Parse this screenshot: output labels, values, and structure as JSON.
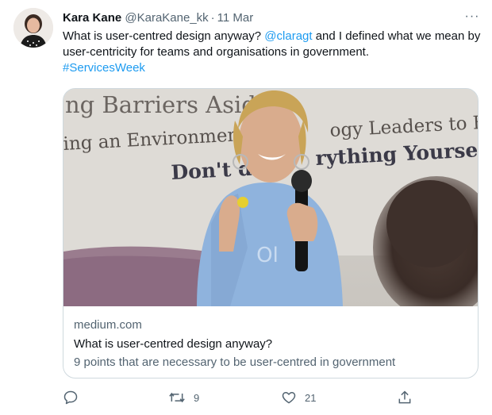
{
  "author": {
    "display_name": "Kara Kane",
    "handle": "@KaraKane_kk",
    "separator": "·",
    "time": "11 Mar"
  },
  "tweet": {
    "text_part1": "What is user-centred design anyway? ",
    "mention": "@claragt",
    "text_part2": " and I defined what we mean by user-centricity for teams and organisations in government.",
    "hashtag": "#ServicesWeek"
  },
  "card": {
    "domain": "medium.com",
    "title": "What is user-centred design anyway?",
    "description": "9 points that are necessary to be user-centred in government",
    "image_banner": {
      "line1": "ng Barriers Aside",
      "line2a": "ing an Environment fo",
      "line2b": "ogy Leaders to Flouri",
      "line3a": "Don't d",
      "line3b": "rything Yourself ("
    }
  },
  "actions": {
    "reply_count": "",
    "retweet_count": "9",
    "like_count": "21"
  },
  "more_label": "···",
  "colors": {
    "accent": "#1d9bf0",
    "secondary_text": "#536471",
    "border": "#cfd9de",
    "sweater": "#8fb3dd",
    "banner": "#dcd9d3"
  },
  "icons": [
    "more-icon",
    "reply-icon",
    "retweet-icon",
    "like-icon",
    "share-icon"
  ]
}
